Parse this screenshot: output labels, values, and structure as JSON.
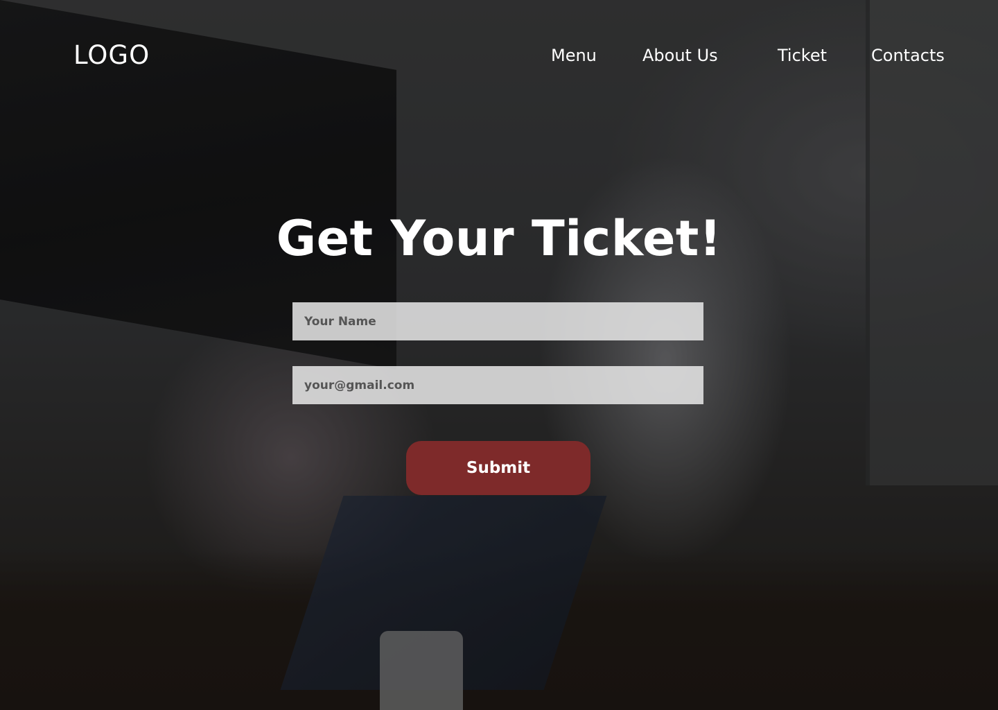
{
  "header": {
    "logo": "LOGO",
    "nav": {
      "menu": "Menu",
      "about": "About Us",
      "ticket": "Ticket",
      "contacts": "Contacts"
    }
  },
  "hero": {
    "title": "Get Your Ticket!",
    "form": {
      "name_placeholder": "Your Name",
      "email_placeholder": "your@gmail.com",
      "submit_label": "Submit"
    }
  },
  "colors": {
    "submit_button": "#7e2a2a",
    "text": "#ffffff",
    "field_background": "#e8e8e8"
  }
}
